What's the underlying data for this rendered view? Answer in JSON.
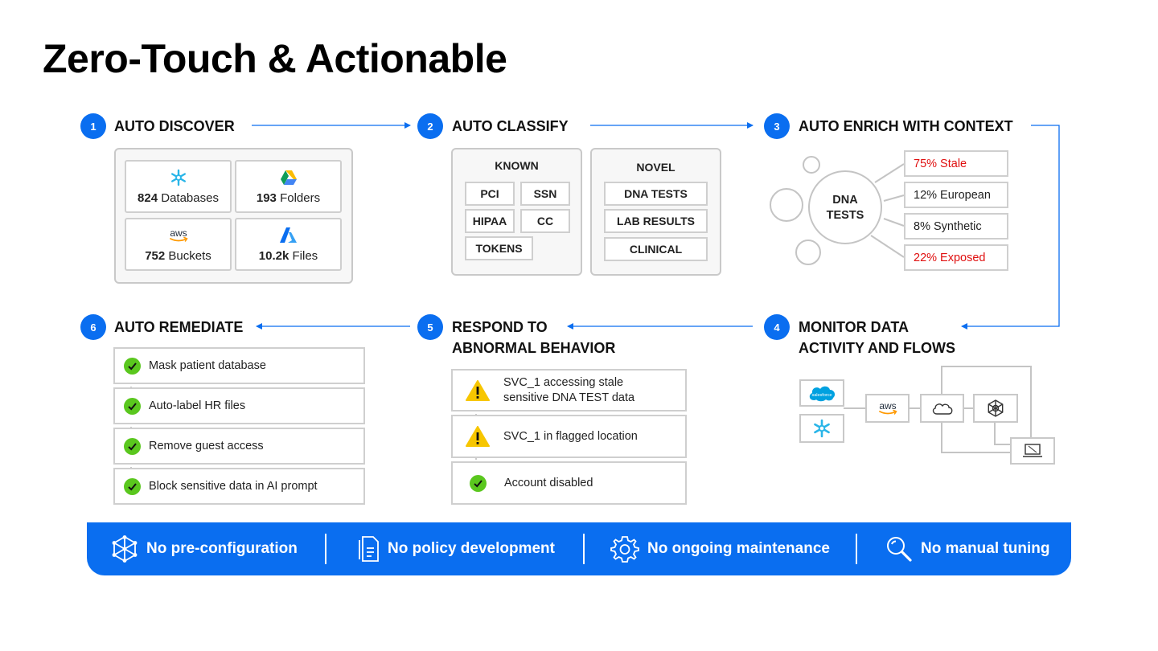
{
  "title": "Zero-Touch & Actionable",
  "steps": [
    {
      "num": "1",
      "title": "AUTO DISCOVER"
    },
    {
      "num": "2",
      "title": "AUTO CLASSIFY"
    },
    {
      "num": "3",
      "title": "AUTO ENRICH WITH CONTEXT"
    },
    {
      "num": "4",
      "title_line1": "MONITOR DATA",
      "title_line2": "ACTIVITY AND FLOWS"
    },
    {
      "num": "5",
      "title_line1": "RESPOND TO",
      "title_line2": "ABNORMAL BEHAVIOR"
    },
    {
      "num": "6",
      "title": "AUTO REMEDIATE"
    }
  ],
  "discover": [
    {
      "icon": "snowflake-icon",
      "count": "824",
      "label": "Databases"
    },
    {
      "icon": "google-drive-icon",
      "count": "193",
      "label": "Folders"
    },
    {
      "icon": "aws-icon",
      "icon_text": "aws",
      "count": "752",
      "label": "Buckets"
    },
    {
      "icon": "azure-icon",
      "count": "10.2k",
      "label": "Files"
    }
  ],
  "classify": {
    "known": {
      "heading": "KNOWN",
      "tags": [
        "PCI",
        "SSN",
        "HIPAA",
        "CC",
        "TOKENS"
      ]
    },
    "novel": {
      "heading": "NOVEL",
      "tags": [
        "DNA TESTS",
        "LAB RESULTS",
        "CLINICAL"
      ]
    }
  },
  "enrich": {
    "center_line1": "DNA",
    "center_line2": "TESTS",
    "items": [
      {
        "text": "75% Stale",
        "highlight": true
      },
      {
        "text": "12% European",
        "highlight": false
      },
      {
        "text": "8% Synthetic",
        "highlight": false
      },
      {
        "text": "22% Exposed",
        "highlight": true
      }
    ]
  },
  "monitor": {
    "salesforce_text": "salesforce",
    "aws_text": "aws"
  },
  "respond": [
    {
      "icon": "warning-icon",
      "line1": "SVC_1 accessing stale",
      "line2": "sensitive DNA TEST data"
    },
    {
      "icon": "warning-icon",
      "line1": "SVC_1 in flagged location",
      "line2": ""
    },
    {
      "icon": "check-icon",
      "line1": "Account disabled",
      "line2": ""
    }
  ],
  "remediate": [
    "Mask patient database",
    "Auto-label HR files",
    "Remove guest access",
    "Block sensitive data in AI prompt"
  ],
  "features": [
    {
      "icon": "network-icon",
      "label": "No pre-configuration"
    },
    {
      "icon": "document-icon",
      "label": "No policy development"
    },
    {
      "icon": "gear-icon",
      "label": "No ongoing maintenance"
    },
    {
      "icon": "search-icon",
      "label": "No manual tuning"
    }
  ],
  "colors": {
    "accent": "#0a6ef0",
    "alert": "#e01010",
    "success": "#5ac71e",
    "warning": "#f7c600"
  }
}
